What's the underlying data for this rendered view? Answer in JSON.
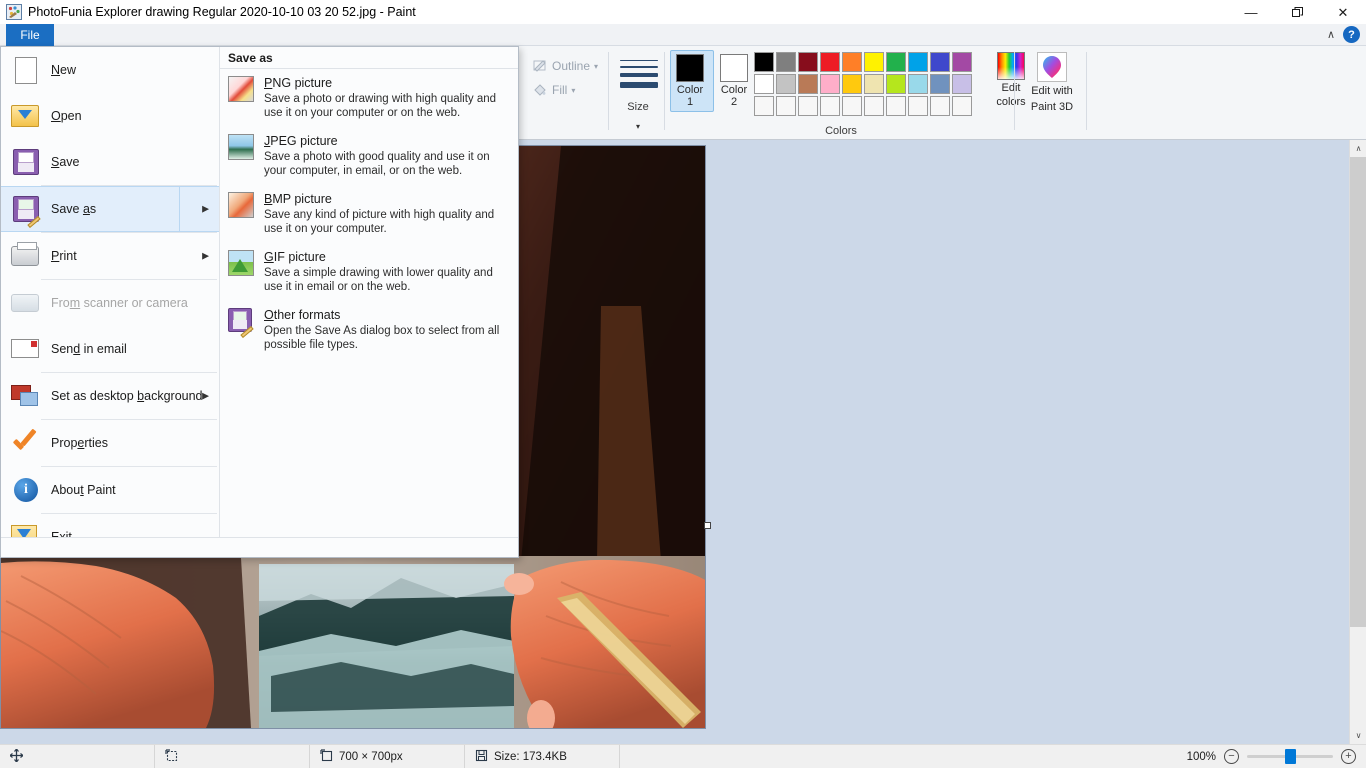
{
  "window": {
    "title": "PhotoFunia Explorer drawing Regular 2020-10-10 03 20 52.jpg - Paint",
    "app_icon": "paint-icon",
    "minimize": "—",
    "maximize": "❐",
    "close": "✕"
  },
  "ribbon": {
    "file_tab": "File",
    "collapse_icon": "∧",
    "help_icon": "?",
    "tools": {
      "outline_label": "Outline",
      "outline_caret": "▾",
      "fill_label": "Fill",
      "fill_caret": "▾"
    },
    "size_group": {
      "label": "Size",
      "caret": "▾"
    },
    "colors_group": {
      "label": "Colors",
      "color1_label": "Color\n1",
      "color1_line1": "Color",
      "color1_line2": "1",
      "color1_value": "#000000",
      "color2_line1": "Color",
      "color2_line2": "2",
      "color2_value": "#ffffff",
      "edit_colors_line1": "Edit",
      "edit_colors_line2": "colors",
      "palette_row1": [
        "#000000",
        "#7f7f7f",
        "#870d1c",
        "#ed1c24",
        "#ff7f27",
        "#fff200",
        "#22b14c",
        "#00a2e8",
        "#3f48cc",
        "#a349a4"
      ],
      "palette_row2": [
        "#ffffff",
        "#c3c3c3",
        "#b97a57",
        "#ffaec9",
        "#ffc90e",
        "#efe4b0",
        "#b5e61d",
        "#99d9ea",
        "#7092be",
        "#c8bfe7"
      ],
      "palette_row3": [
        "#f7f7f7",
        "#f7f7f7",
        "#f7f7f7",
        "#f7f7f7",
        "#f7f7f7",
        "#f7f7f7",
        "#f7f7f7",
        "#f7f7f7",
        "#f7f7f7",
        "#f7f7f7"
      ]
    },
    "paint3d": {
      "line1": "Edit with",
      "line2": "Paint 3D",
      "icon": "paint3d-icon"
    }
  },
  "file_menu": {
    "items": [
      {
        "label_pre": "",
        "label_key": "N",
        "label_post": "ew",
        "icon": "new-document-icon",
        "arrow": "",
        "disabled": false,
        "selected": false
      },
      {
        "label_pre": "",
        "label_key": "O",
        "label_post": "pen",
        "icon": "open-folder-icon",
        "arrow": "",
        "disabled": false,
        "selected": false
      },
      {
        "label_pre": "",
        "label_key": "S",
        "label_post": "ave",
        "icon": "save-floppy-icon",
        "arrow": "",
        "disabled": false,
        "selected": false
      },
      {
        "label_pre": "Save ",
        "label_key": "a",
        "label_post": "s",
        "icon": "save-as-icon",
        "arrow": "▶",
        "disabled": false,
        "selected": true
      },
      {
        "label_pre": "",
        "label_key": "P",
        "label_post": "rint",
        "icon": "printer-icon",
        "arrow": "▶",
        "disabled": false,
        "selected": false
      },
      {
        "label_pre": "Fro",
        "label_key": "m",
        "label_post": " scanner or camera",
        "icon": "scanner-icon",
        "arrow": "",
        "disabled": true,
        "selected": false
      },
      {
        "label_pre": "Sen",
        "label_key": "d",
        "label_post": " in email",
        "icon": "email-icon",
        "arrow": "",
        "disabled": false,
        "selected": false
      },
      {
        "label_pre": "Set as desktop ",
        "label_key": "b",
        "label_post": "ackground",
        "icon": "desktop-background-icon",
        "arrow": "▶",
        "disabled": false,
        "selected": false
      },
      {
        "label_pre": "Prop",
        "label_key": "e",
        "label_post": "rties",
        "icon": "properties-check-icon",
        "arrow": "",
        "disabled": false,
        "selected": false
      },
      {
        "label_pre": "Abou",
        "label_key": "t",
        "label_post": " Paint",
        "icon": "about-info-icon",
        "arrow": "",
        "disabled": false,
        "selected": false
      },
      {
        "label_pre": "E",
        "label_key": "x",
        "label_post": "it",
        "icon": "exit-icon",
        "arrow": "",
        "disabled": false,
        "selected": false
      }
    ],
    "save_as": {
      "title": "Save as",
      "options": [
        {
          "key": "P",
          "title_pre": "",
          "title_post": "NG picture",
          "desc": "Save a photo or drawing with high quality and use it on your computer or on the web.",
          "icon": "png-thumb-icon"
        },
        {
          "key": "J",
          "title_pre": "",
          "title_post": "PEG picture",
          "desc": "Save a photo with good quality and use it on your computer, in email, or on the web.",
          "icon": "jpeg-thumb-icon"
        },
        {
          "key": "B",
          "title_pre": "",
          "title_post": "MP picture",
          "desc": "Save any kind of picture with high quality and use it on your computer.",
          "icon": "bmp-thumb-icon"
        },
        {
          "key": "G",
          "title_pre": "",
          "title_post": "IF picture",
          "desc": "Save a simple drawing with lower quality and use it in email or on the web.",
          "icon": "gif-thumb-icon"
        },
        {
          "key": "O",
          "title_pre": "",
          "title_post": "ther formats",
          "desc": "Open the Save As dialog box to select from all possible file types.",
          "icon": "other-formats-icon"
        }
      ]
    }
  },
  "canvas": {
    "image_description": "photo of two hands holding an open book with a map page and a black-and-white mountain photograph, lit with orange light",
    "resize_handle": "canvas-resize-handle"
  },
  "scrollbar": {
    "up_arrow": "∧",
    "down_arrow": "∨"
  },
  "statusbar": {
    "cursor_icon": "cursor-position-icon",
    "cursor_value": "",
    "selection_icon": "selection-size-icon",
    "selection_value": "",
    "image_size_icon": "image-dimensions-icon",
    "image_size": "700 × 700px",
    "file_size_icon": "file-size-icon",
    "file_size": "Size: 173.4KB",
    "zoom_percent": "100%",
    "zoom_out": "−",
    "zoom_in": "+"
  }
}
